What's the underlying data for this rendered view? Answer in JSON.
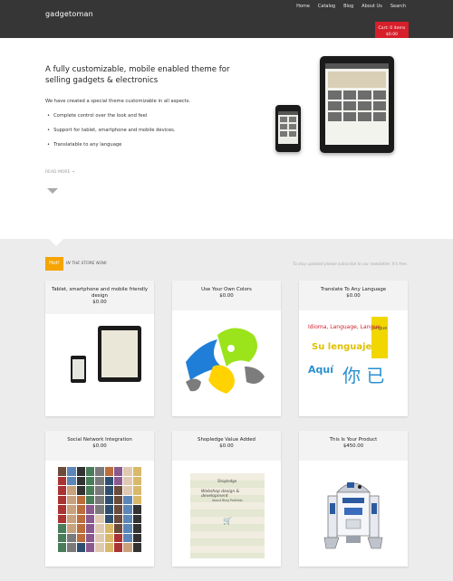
{
  "header": {
    "logo": "gadgetoman",
    "nav": [
      "Home",
      "Catalog",
      "Blog",
      "About Us",
      "Search"
    ],
    "cart_label": "Cart: 0 items",
    "cart_total": "$0.00"
  },
  "hero": {
    "headline": "A fully customizable, mobile enabled theme for selling gadgets & electronics",
    "intro": "We have created a special theme customizable in all aspects.",
    "bullets": [
      "Complete control over the look and feel",
      "Support for tablet, smartphone and mobile devices.",
      "Translatable to any language"
    ],
    "read_more": "READ MORE →"
  },
  "store": {
    "badge": "Hot!",
    "tagline": "IN THE STORE NOW.",
    "subscribe": "To stay updated please subscribe to our newsletter. It's free."
  },
  "products": [
    {
      "title": "Tablet, smartphone and mobile friendly design",
      "price": "$0.00"
    },
    {
      "title": "Use Your Own Colors",
      "price": "$0.00"
    },
    {
      "title": "Translate To Any Language",
      "price": "$0.00"
    },
    {
      "title": "Social Network Integration",
      "price": "$0.00"
    },
    {
      "title": "Shopledge Value Added",
      "price": "$0.00"
    },
    {
      "title": "This Is Your Product",
      "price": "$450.00"
    }
  ],
  "images": {
    "language": {
      "line1": "Idioma, Language, Langue",
      "line2": "Su lenguaje",
      "line3": "Aquí",
      "line4": "你 已",
      "side": "lingue"
    },
    "shopledge": {
      "heading": "Shopledge",
      "script": "Webshop design & development",
      "menu": "About  Blog  Portfolio"
    }
  },
  "colors": {
    "topbar": "#363636",
    "cart": "#d61f2a",
    "hot": "#f5a400",
    "section_bg": "#ececec"
  }
}
